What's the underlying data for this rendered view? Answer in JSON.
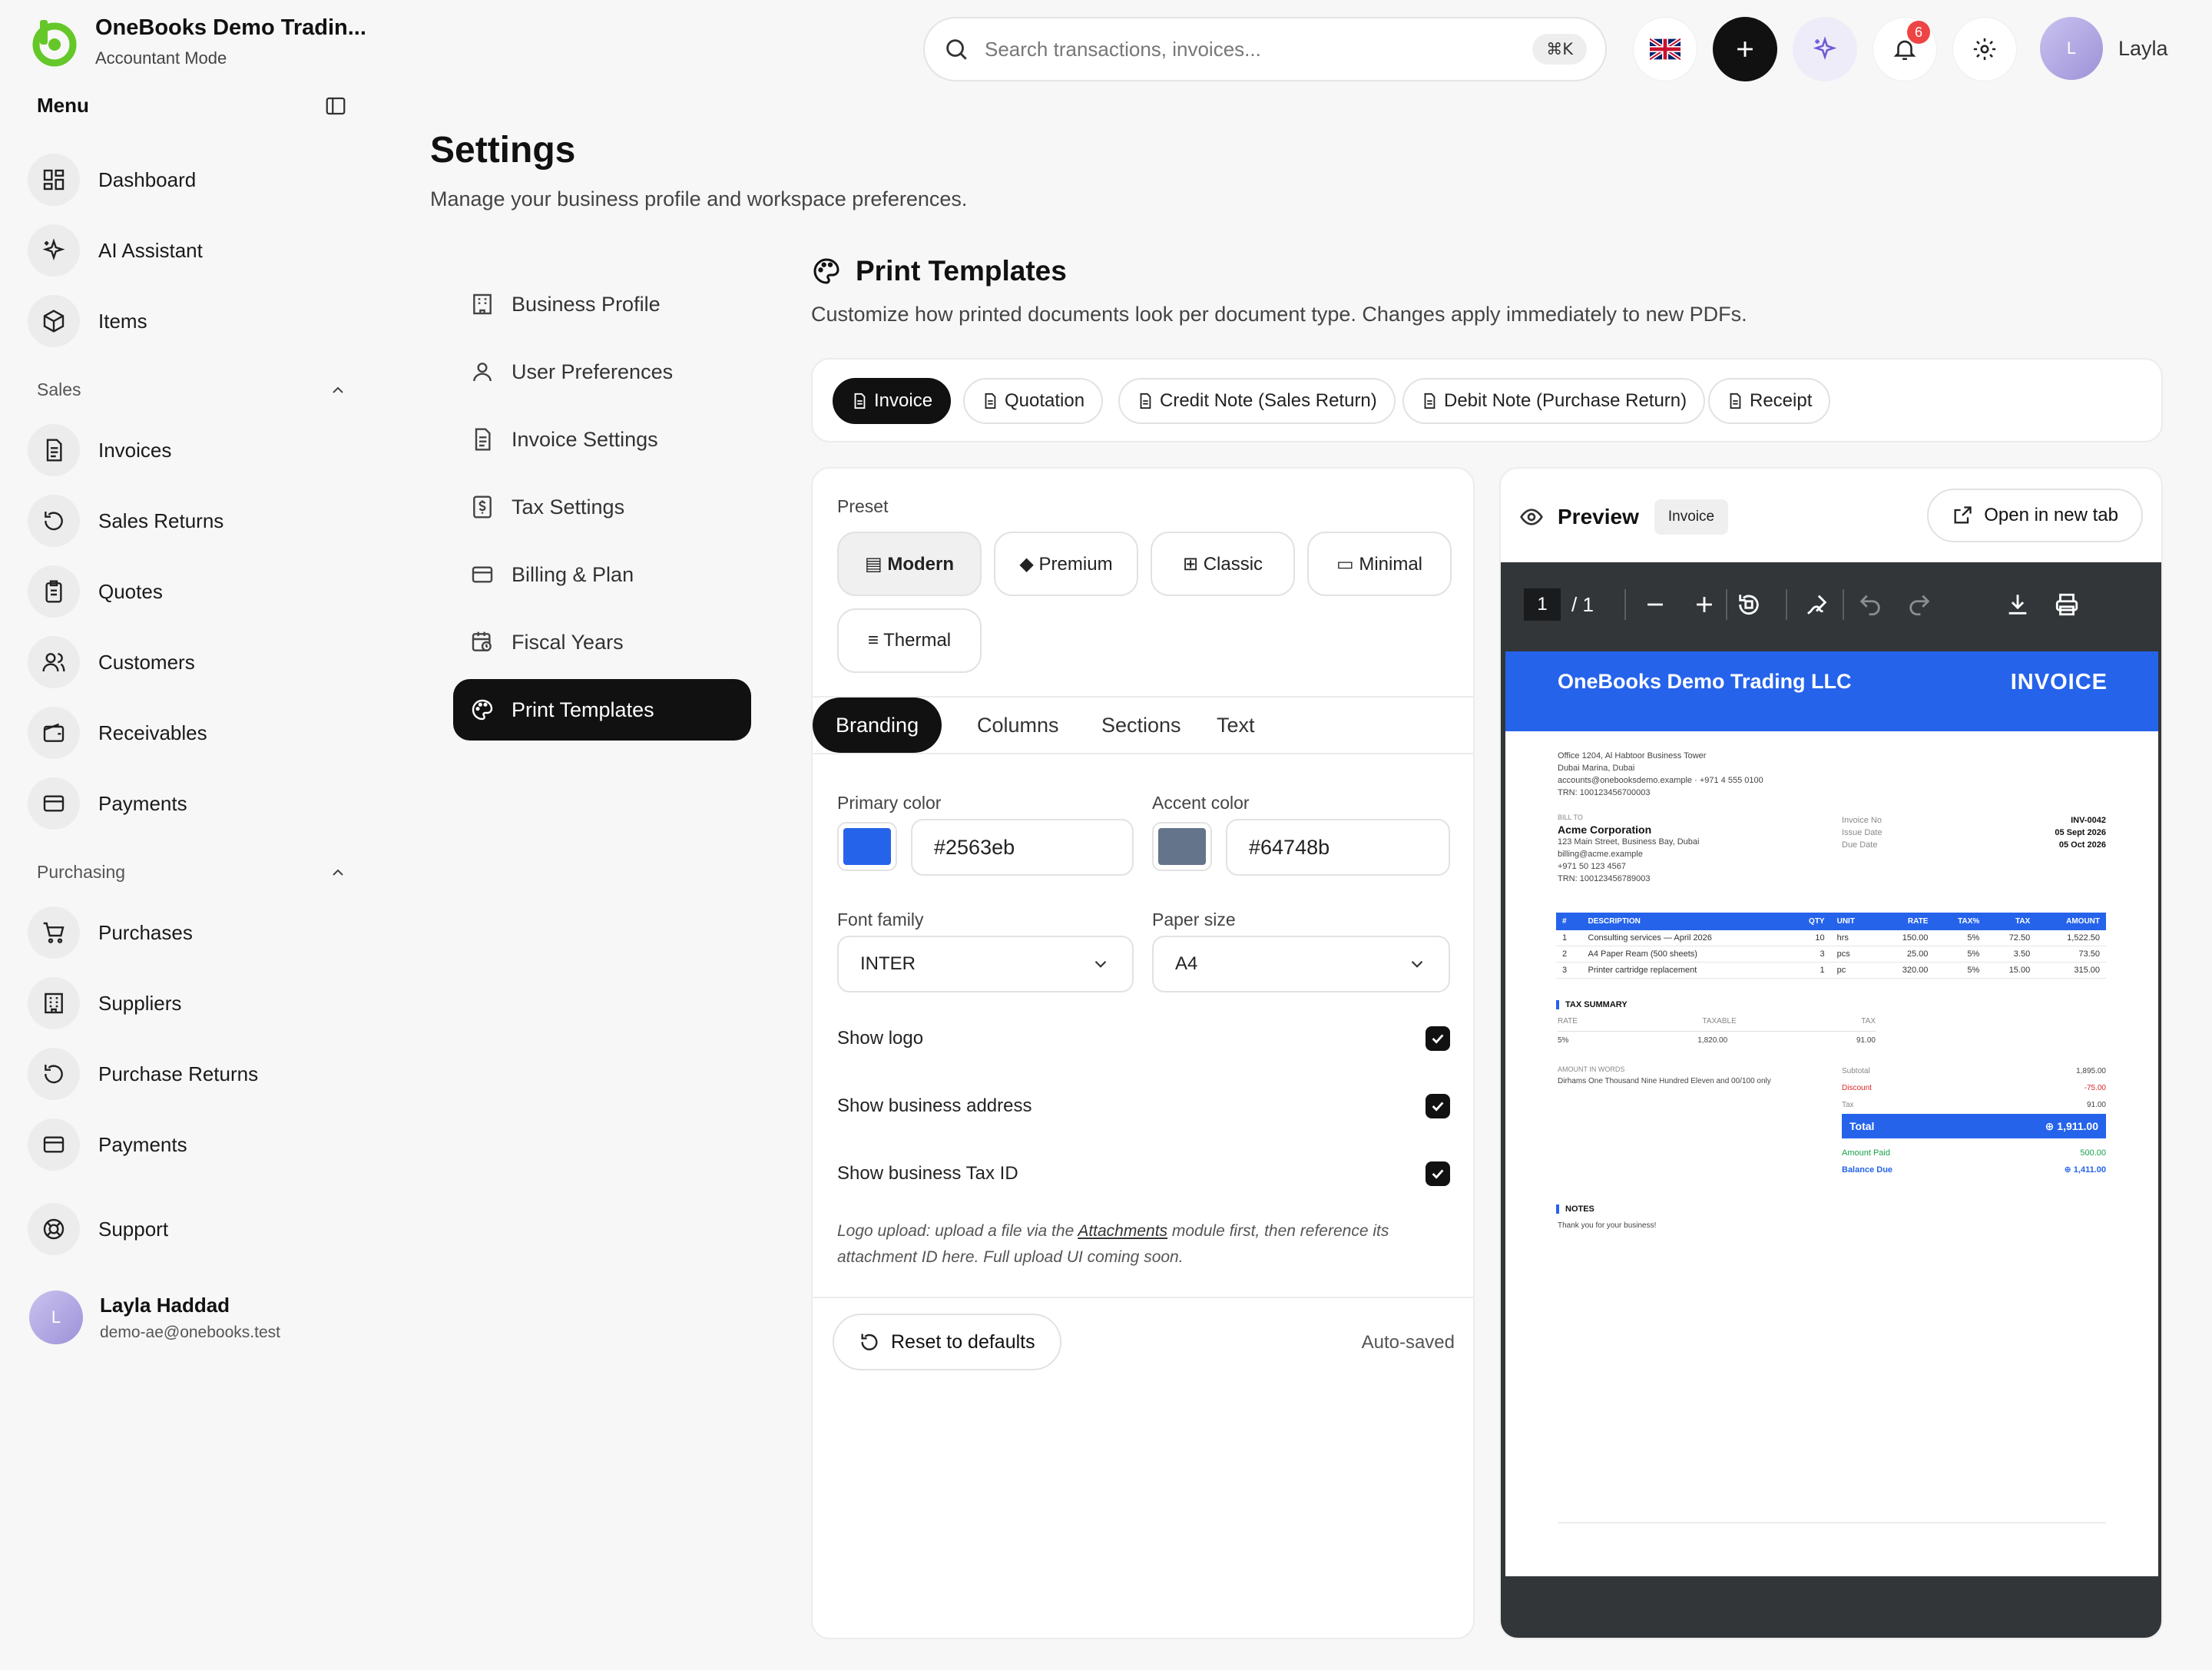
{
  "app": {
    "company": "OneBooks Demo Tradin...",
    "mode": "Accountant Mode",
    "menu_title": "Menu"
  },
  "sidebar": {
    "top_items": [
      {
        "label": "Dashboard",
        "icon": "dashboard-icon"
      },
      {
        "label": "AI Assistant",
        "icon": "sparkles-icon"
      },
      {
        "label": "Items",
        "icon": "box-icon"
      }
    ],
    "sales": {
      "title": "Sales",
      "items": [
        {
          "label": "Invoices",
          "icon": "file-icon"
        },
        {
          "label": "Sales Returns",
          "icon": "return-icon"
        },
        {
          "label": "Quotes",
          "icon": "clipboard-icon"
        },
        {
          "label": "Customers",
          "icon": "users-icon"
        },
        {
          "label": "Receivables",
          "icon": "wallet-icon"
        },
        {
          "label": "Payments",
          "icon": "card-icon"
        }
      ]
    },
    "purchasing": {
      "title": "Purchasing",
      "items": [
        {
          "label": "Purchases",
          "icon": "cart-icon"
        },
        {
          "label": "Suppliers",
          "icon": "building-icon"
        },
        {
          "label": "Purchase Returns",
          "icon": "return-icon"
        },
        {
          "label": "Payments",
          "icon": "card-icon"
        }
      ]
    },
    "support": "Support",
    "user": {
      "name": "Layla Haddad",
      "email": "demo-ae@onebooks.test",
      "initial": "L"
    }
  },
  "topbar": {
    "search_placeholder": "Search transactions, invoices...",
    "shortcut": "⌘K",
    "notification_count": "6",
    "user_name": "Layla",
    "user_initial": "L"
  },
  "page": {
    "title": "Settings",
    "subtitle": "Manage your business profile and workspace preferences."
  },
  "settings_nav": [
    {
      "label": "Business Profile",
      "active": false
    },
    {
      "label": "User Preferences",
      "active": false
    },
    {
      "label": "Invoice Settings",
      "active": false
    },
    {
      "label": "Tax Settings",
      "active": false
    },
    {
      "label": "Billing & Plan",
      "active": false
    },
    {
      "label": "Fiscal Years",
      "active": false
    },
    {
      "label": "Print Templates",
      "active": true
    }
  ],
  "print_templates": {
    "title": "Print Templates",
    "subtitle": "Customize how printed documents look per document type. Changes apply immediately to new PDFs.",
    "doc_types": [
      "Invoice",
      "Quotation",
      "Credit Note (Sales Return)",
      "Debit Note (Purchase Return)",
      "Receipt"
    ],
    "active_doc_type": "Invoice",
    "preset_label": "Preset",
    "presets": [
      "▤ Modern",
      "◆ Premium",
      "⊞ Classic",
      "▭ Minimal",
      "≡ Thermal"
    ],
    "active_preset": "Modern",
    "sub_tabs": [
      "Branding",
      "Columns",
      "Sections",
      "Text"
    ],
    "active_sub_tab": "Branding",
    "primary_color_label": "Primary color",
    "primary_color": "#2563eb",
    "accent_color_label": "Accent color",
    "accent_color": "#64748b",
    "font_family_label": "Font family",
    "font_family": "INTER",
    "paper_size_label": "Paper size",
    "paper_size": "A4",
    "toggles": [
      {
        "label": "Show logo",
        "checked": true
      },
      {
        "label": "Show business address",
        "checked": true
      },
      {
        "label": "Show business Tax ID",
        "checked": true
      }
    ],
    "hint_pre": "Logo upload: upload a file via the ",
    "hint_link": "Attachments",
    "hint_post": " module first, then reference its attachment ID here. Full upload UI coming soon.",
    "reset_label": "Reset to defaults",
    "autosaved": "Auto-saved"
  },
  "preview": {
    "title": "Preview",
    "chip": "Invoice",
    "open_tab": "Open in new tab",
    "page_current": "1",
    "page_total": "/ 1",
    "pdf": {
      "company": "OneBooks Demo Trading LLC",
      "doc_title": "INVOICE",
      "address_1": "Office 1204, Al Habtoor Business Tower",
      "address_2": "Dubai Marina, Dubai",
      "contact": "accounts@onebooksdemo.example · +971 4 555 0100",
      "trn": "TRN: 100123456700003",
      "bill_to_label": "BILL TO",
      "customer": "Acme Corporation",
      "cust_address": "123 Main Street, Business Bay, Dubai",
      "cust_email": "billing@acme.example",
      "cust_phone": "+971 50 123 4567",
      "cust_trn": "TRN: 100123456789003",
      "meta": [
        {
          "label": "Invoice No",
          "value": "INV-0042"
        },
        {
          "label": "Issue Date",
          "value": "05 Sept 2026"
        },
        {
          "label": "Due Date",
          "value": "05 Oct 2026"
        }
      ],
      "columns": [
        "#",
        "DESCRIPTION",
        "QTY",
        "UNIT",
        "RATE",
        "TAX%",
        "TAX",
        "AMOUNT"
      ],
      "rows": [
        [
          "1",
          "Consulting services — April 2026",
          "10",
          "hrs",
          "150.00",
          "5%",
          "72.50",
          "1,522.50"
        ],
        [
          "2",
          "A4 Paper Ream (500 sheets)",
          "3",
          "pcs",
          "25.00",
          "5%",
          "3.50",
          "73.50"
        ],
        [
          "3",
          "Printer cartridge replacement",
          "1",
          "pc",
          "320.00",
          "5%",
          "15.00",
          "315.00"
        ]
      ],
      "tax_summary_label": "TAX SUMMARY",
      "tax_cols": [
        "RATE",
        "TAXABLE",
        "TAX"
      ],
      "tax_row": [
        "5%",
        "1,820.00",
        "91.00"
      ],
      "words_label": "AMOUNT IN WORDS",
      "words": "Dirhams One Thousand Nine Hundred Eleven and 00/100 only",
      "subtotal_label": "Subtotal",
      "subtotal": "1,895.00",
      "discount_label": "Discount",
      "discount": "-75.00",
      "tax_label": "Tax",
      "tax": "91.00",
      "total_label": "Total",
      "total": "⊕ 1,911.00",
      "paid_label": "Amount Paid",
      "paid": "500.00",
      "balance_label": "Balance Due",
      "balance": "⊕ 1,411.00",
      "notes_label": "NOTES",
      "notes": "Thank you for your business!"
    }
  }
}
